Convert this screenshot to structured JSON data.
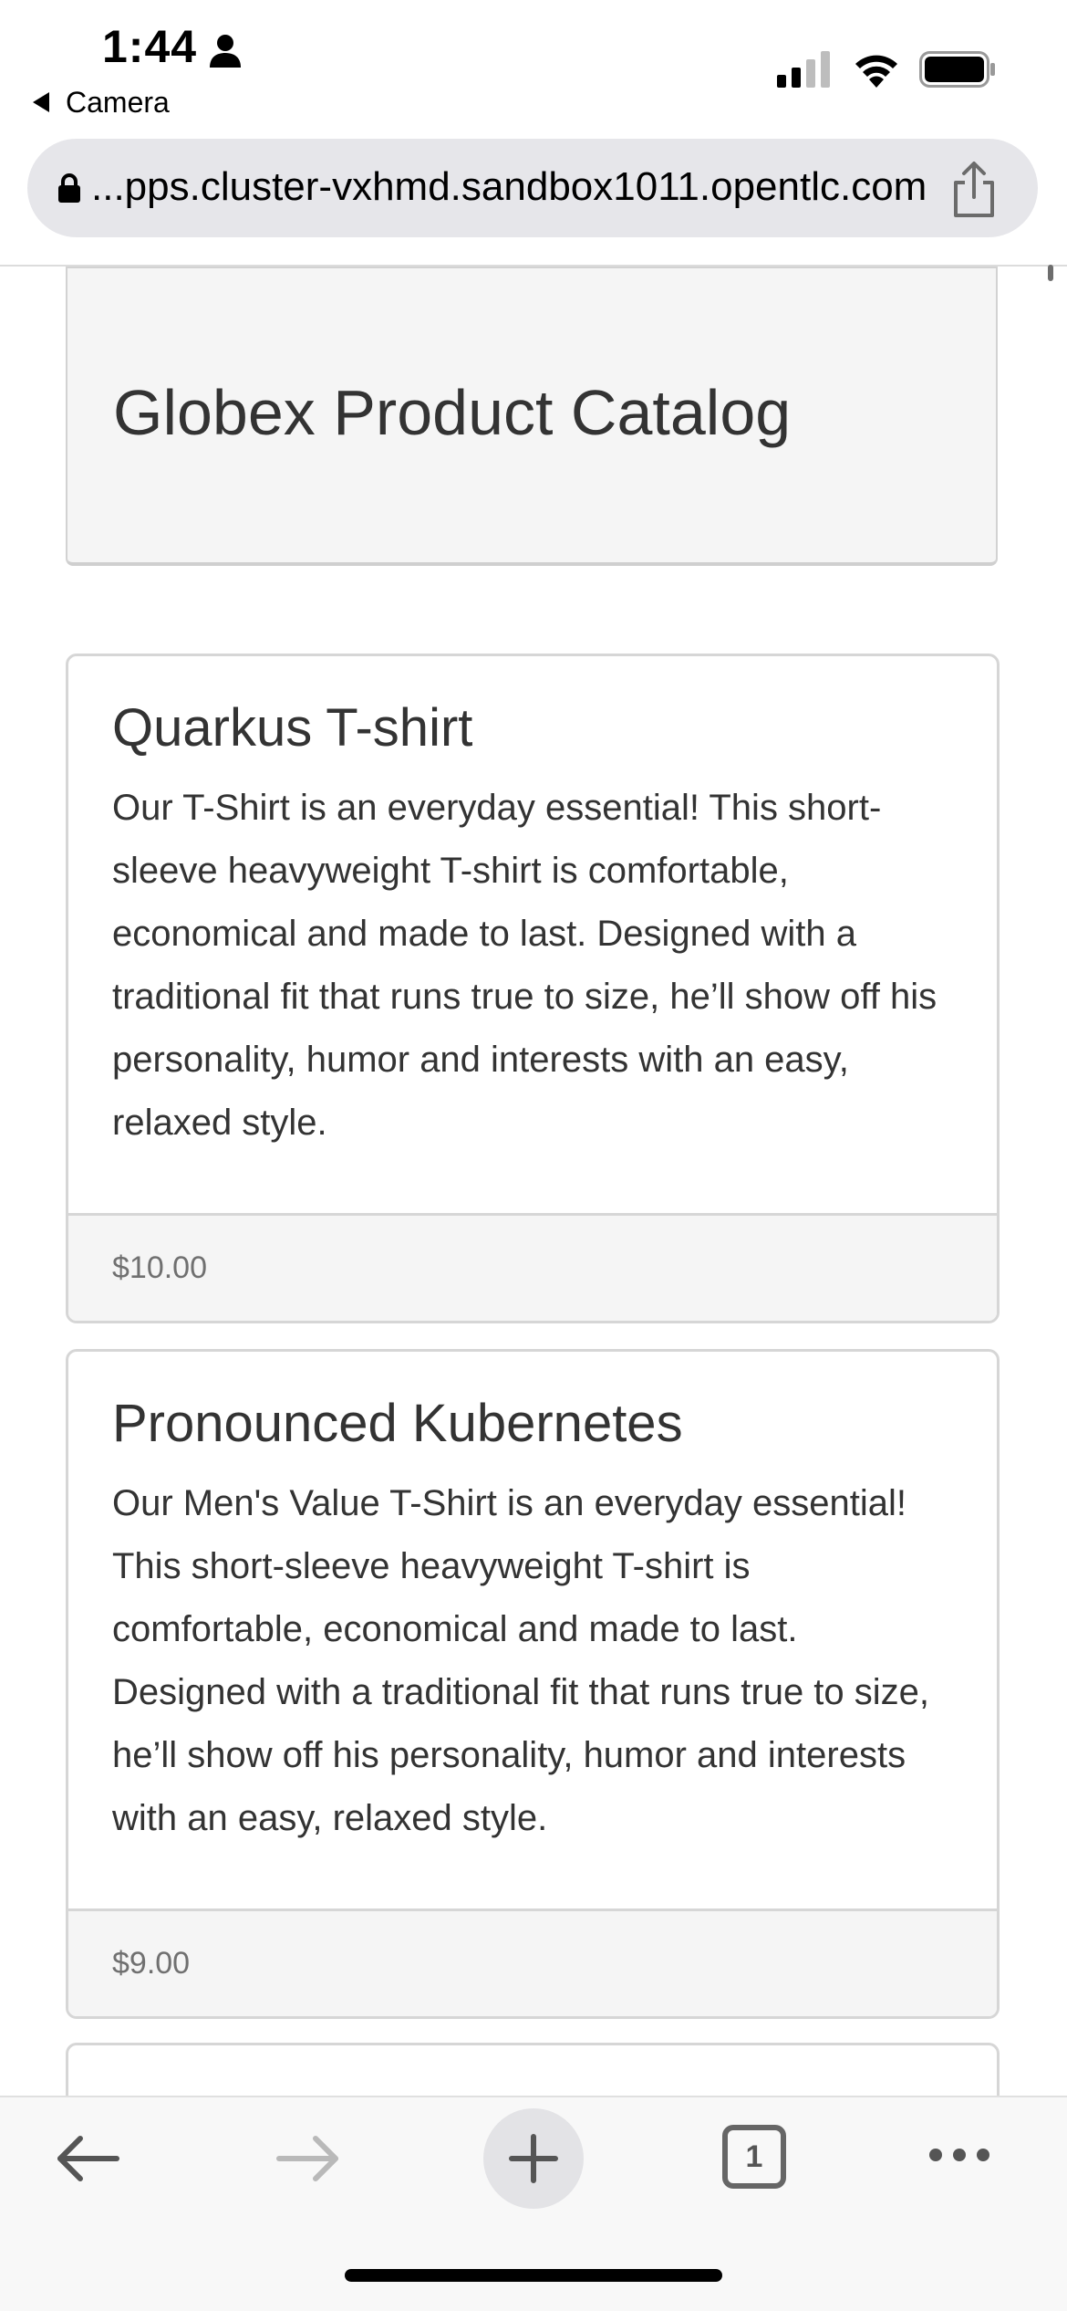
{
  "status_bar": {
    "time": "1:44",
    "back_app_label": "Camera",
    "icons": [
      "person-icon",
      "signal-icon",
      "wifi-icon",
      "battery-icon"
    ]
  },
  "browser": {
    "url": "...pps.cluster-vxhmd.sandbox1011.opentlc.com",
    "tab_count": "1",
    "icons": [
      "lock-icon",
      "share-icon",
      "back-arrow-icon",
      "forward-arrow-icon",
      "plus-icon",
      "more-icon"
    ]
  },
  "page": {
    "title": "Globex Product Catalog",
    "products": [
      {
        "name": "Quarkus T-shirt",
        "description": "Our T-Shirt is an everyday essential! This short-sleeve heavyweight T-shirt is comfortable, economical and made to last. Designed with a traditional fit that runs true to size, he’ll show off his personality, humor and interests with an easy, relaxed style.",
        "price": "$10.00"
      },
      {
        "name": "Pronounced Kubernetes",
        "description": "Our Men's Value T-Shirt is an everyday essential! This short-sleeve heavyweight T-shirt is comfortable, economical and made to last. Designed with a traditional fit that runs true to size, he’ll show off his personality, humor and interests with an easy, relaxed style.",
        "price": "$9.00"
      }
    ]
  },
  "colors": {
    "card_border": "#d6d6d6",
    "footer_bg": "#f5f5f5",
    "url_bar_bg": "#e6e6ea",
    "price_text": "#707070"
  }
}
